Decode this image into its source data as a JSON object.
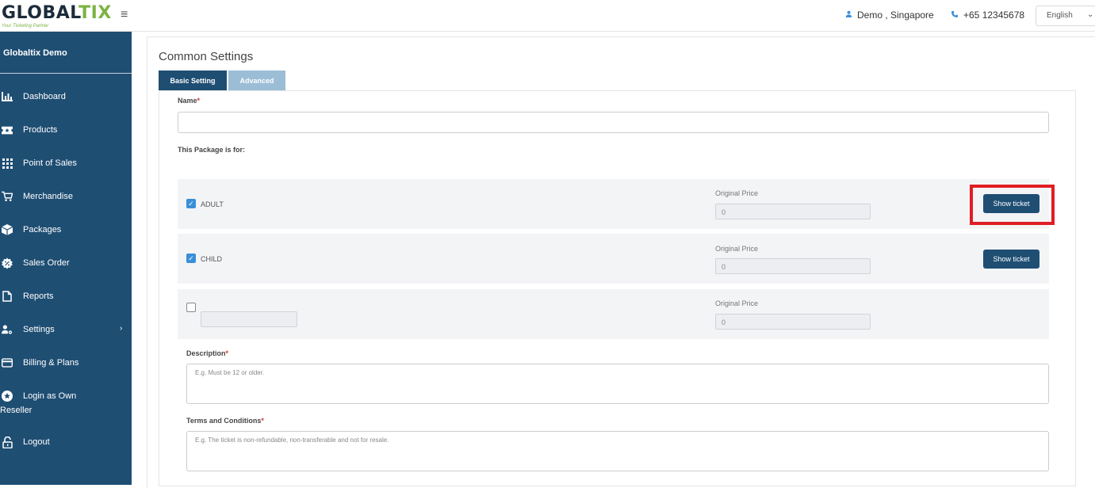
{
  "header": {
    "logo_text_a": "GLOBAL",
    "logo_text_b": "TIX",
    "logo_tagline": "Your Ticketing Partner",
    "user": "Demo , Singapore",
    "phone": "+65 12345678",
    "language": "English"
  },
  "sidebar": {
    "title": "Globaltix Demo",
    "items": [
      {
        "label": "Dashboard",
        "icon": "bar-chart-icon"
      },
      {
        "label": "Products",
        "icon": "ticket-icon"
      },
      {
        "label": "Point of Sales",
        "icon": "grid-icon"
      },
      {
        "label": "Merchandise",
        "icon": "cart-icon"
      },
      {
        "label": "Packages",
        "icon": "box-icon"
      },
      {
        "label": "Sales Order",
        "icon": "badge-icon"
      },
      {
        "label": "Reports",
        "icon": "file-icon"
      },
      {
        "label": "Settings",
        "icon": "user-gear-icon"
      },
      {
        "label": "Billing & Plans",
        "icon": "card-icon"
      }
    ],
    "login_line1": "Login as Own",
    "login_line2": "Reseller",
    "logout": "Logout"
  },
  "main": {
    "title": "Common Settings",
    "tabs": [
      {
        "label": "Basic Setting",
        "active": true
      },
      {
        "label": "Advanced",
        "active": false
      }
    ],
    "name_label": "Name",
    "name_value": "",
    "package_for_label": "This Package is for:",
    "packages": [
      {
        "checked": true,
        "label": "ADULT",
        "price_label": "Original Price",
        "price": "0",
        "button": "Show ticket"
      },
      {
        "checked": true,
        "label": "CHILD",
        "price_label": "Original Price",
        "price": "0",
        "button": "Show ticket"
      },
      {
        "checked": false,
        "label": "",
        "price_label": "Original Price",
        "price": "0"
      }
    ],
    "description_label": "Description",
    "description_placeholder": "E.g. Must be 12 or older.",
    "terms_label": "Terms and Conditions",
    "terms_placeholder": "E.g. The ticket is non-refundable, non-transferable and not for resale.",
    "required_mark": "*"
  },
  "colors": {
    "sidebar": "#1f4e73",
    "accent": "#3a8fd8",
    "highlight": "#e01e25"
  }
}
